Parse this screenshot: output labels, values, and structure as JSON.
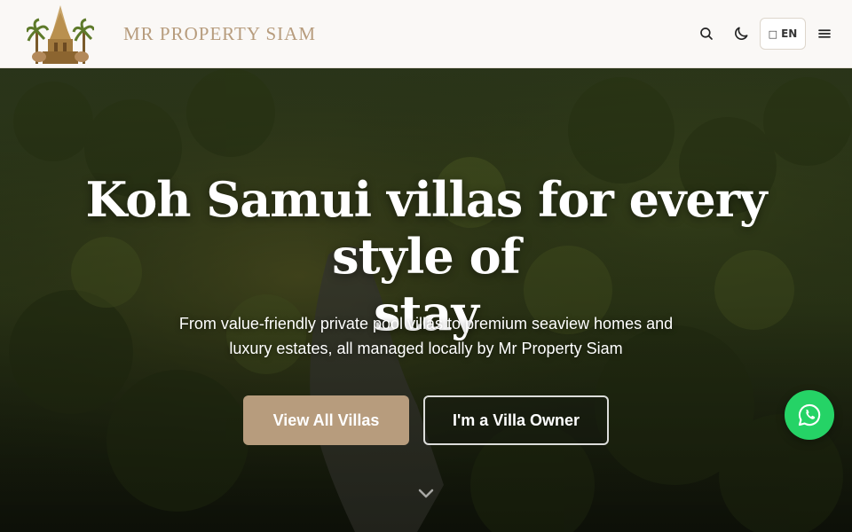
{
  "header": {
    "brand": "MR PROPERTY SIAM",
    "lang_icon": "globe-icon",
    "lang_label": "EN",
    "search_icon": "search-icon",
    "theme_icon": "moon-icon",
    "menu_icon": "hamburger-menu-icon"
  },
  "hero": {
    "headline_line1": "Koh Samui villas for every style of",
    "headline_line2": "stay",
    "subhead_line1": "From value-friendly private pool villas to premium seaview homes and",
    "subhead_line2": "luxury estates, all managed locally by Mr Property Siam",
    "primary_cta": "View All Villas",
    "secondary_cta": "I'm a Villa Owner",
    "scroll_icon": "chevron-down-icon"
  },
  "floating": {
    "whatsapp_icon": "whatsapp-icon"
  },
  "colors": {
    "accent": "#b79c7d",
    "header_bg": "#faf8f6",
    "whatsapp": "#25d366"
  }
}
